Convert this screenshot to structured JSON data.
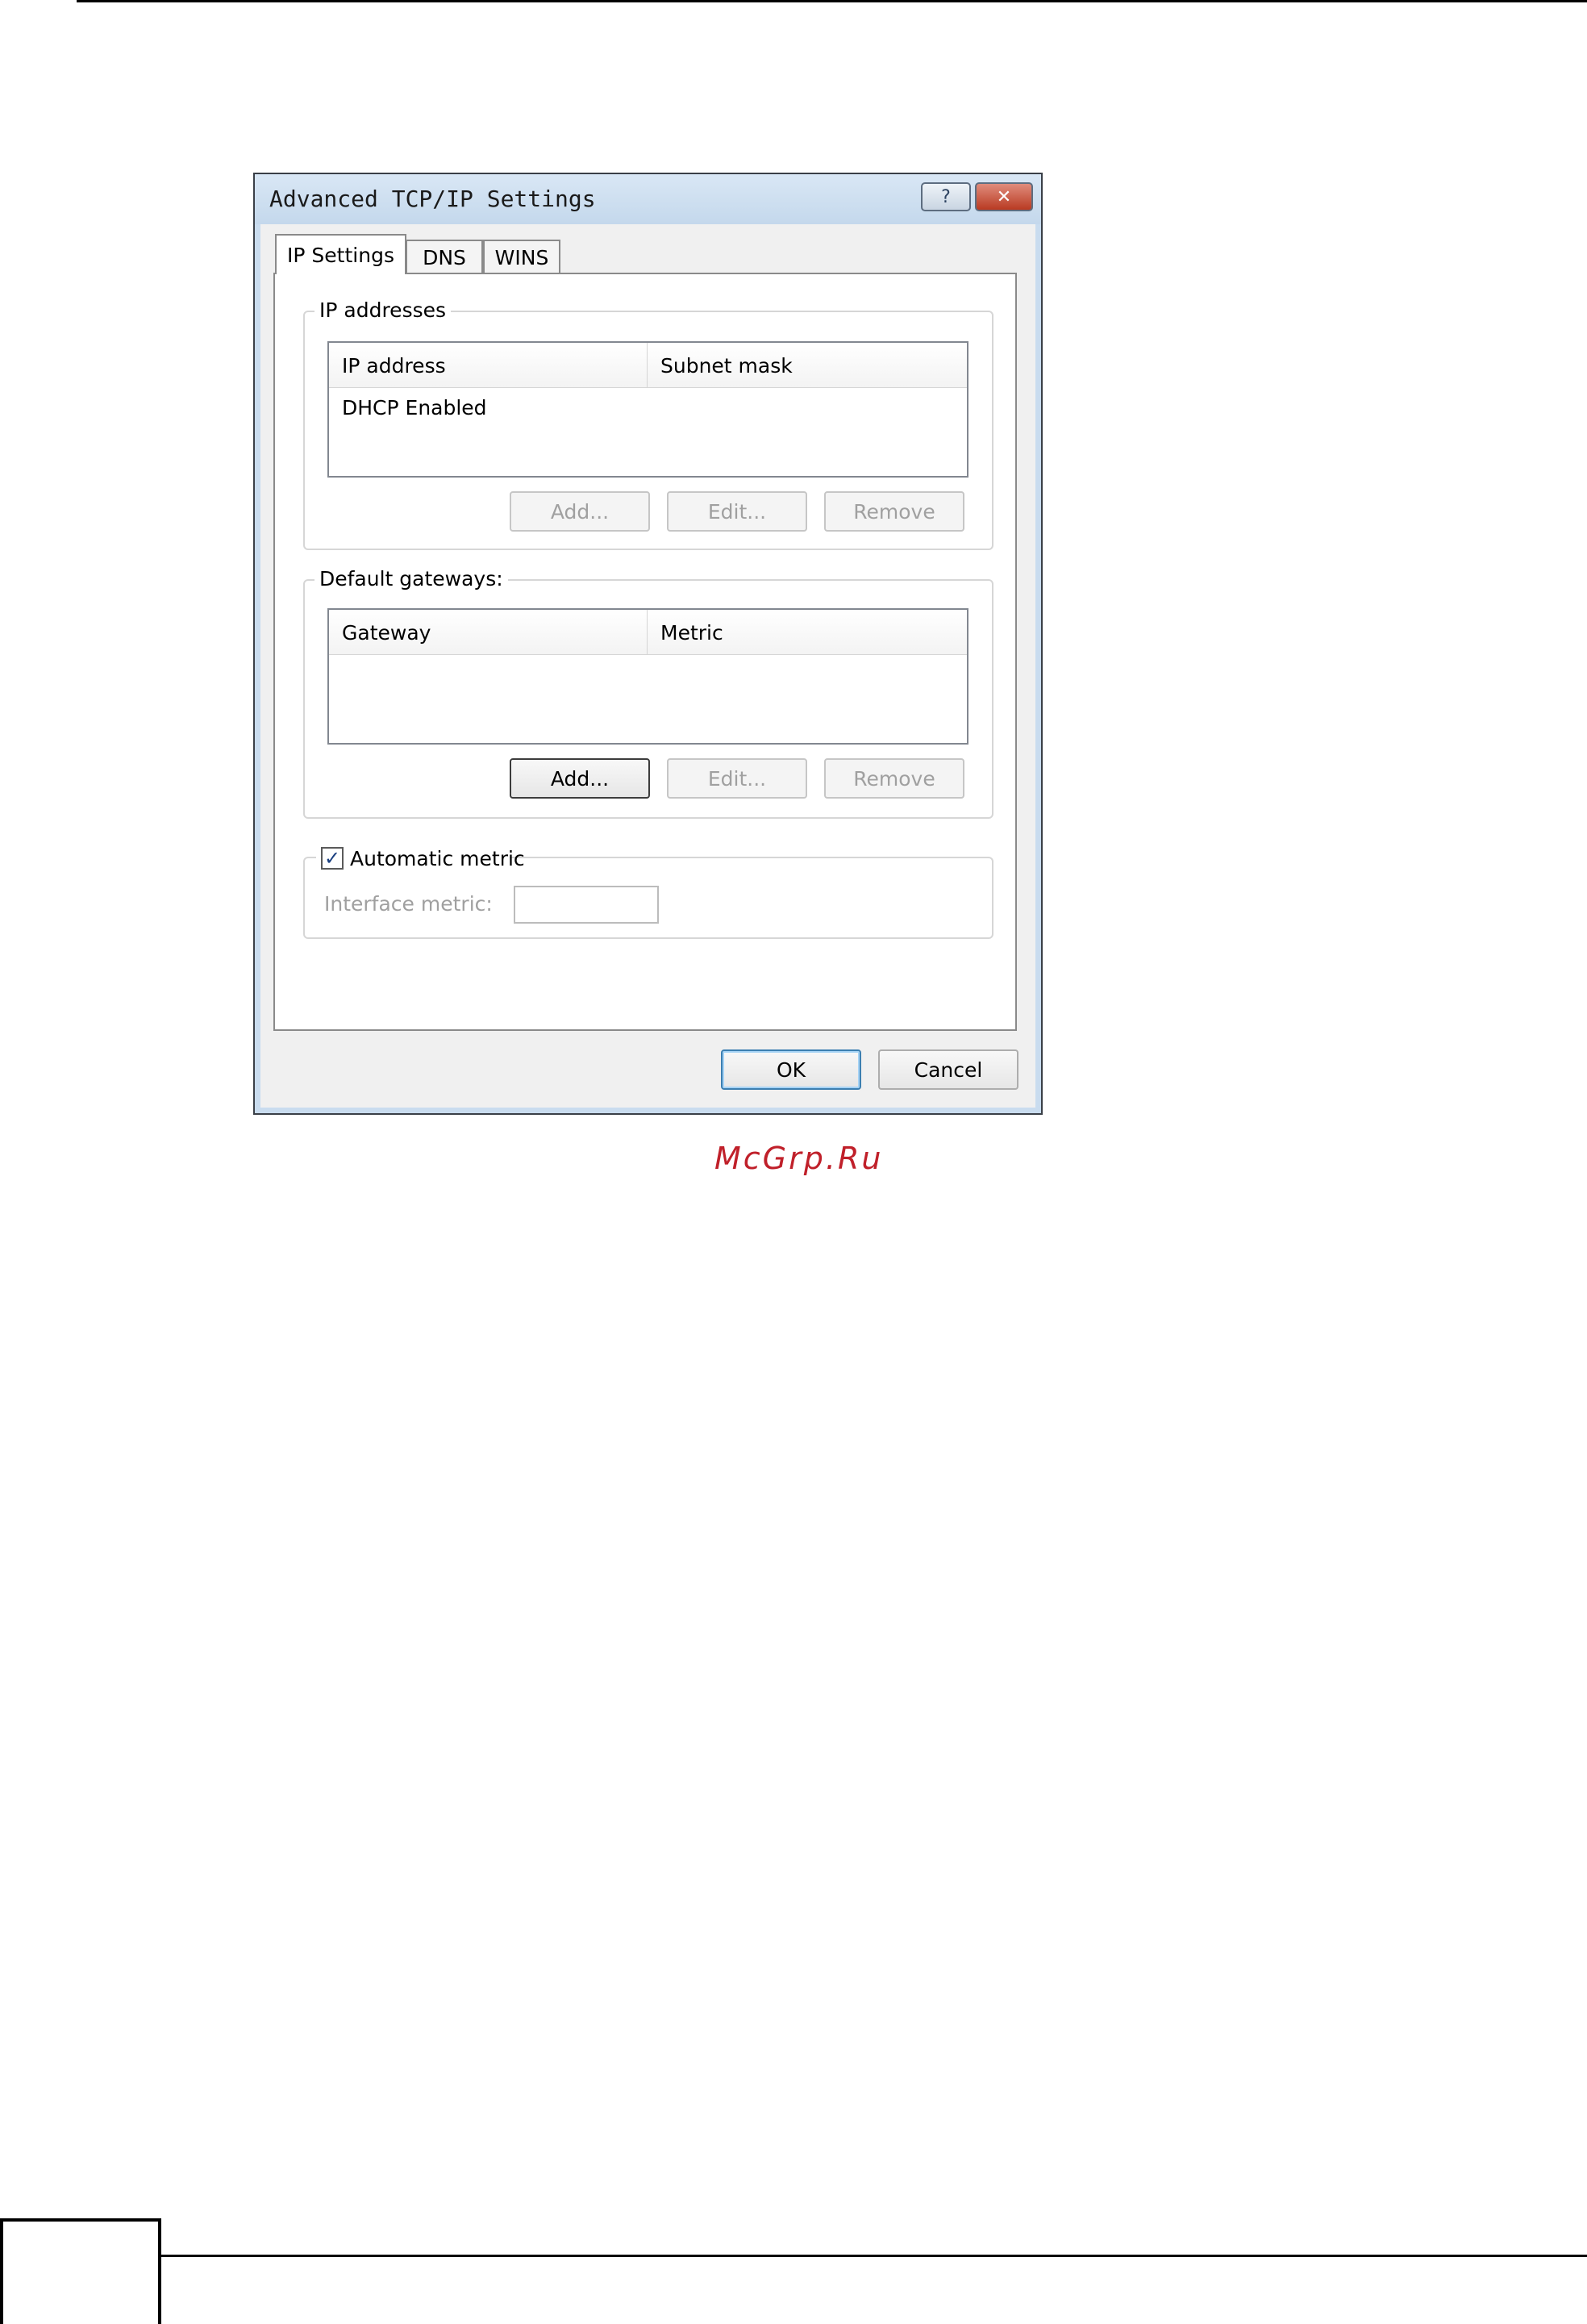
{
  "dialog": {
    "title": "Advanced TCP/IP Settings",
    "help_label": "?",
    "close_label": "✕",
    "tabs": [
      "IP Settings",
      "DNS",
      "WINS"
    ]
  },
  "ip_addresses": {
    "legend": "IP addresses",
    "columns": [
      "IP address",
      "Subnet mask"
    ],
    "rows": [
      [
        "DHCP Enabled",
        ""
      ]
    ],
    "buttons": [
      "Add...",
      "Edit...",
      "Remove"
    ]
  },
  "default_gateways": {
    "legend": "Default gateways:",
    "columns": [
      "Gateway",
      "Metric"
    ],
    "rows": [],
    "buttons": [
      "Add...",
      "Edit...",
      "Remove"
    ]
  },
  "metric": {
    "automatic_label": "Automatic metric",
    "automatic_checked": true,
    "interface_label": "Interface metric:",
    "interface_value": ""
  },
  "footer": {
    "ok_label": "OK",
    "cancel_label": "Cancel"
  },
  "watermark": "McGrp.Ru"
}
